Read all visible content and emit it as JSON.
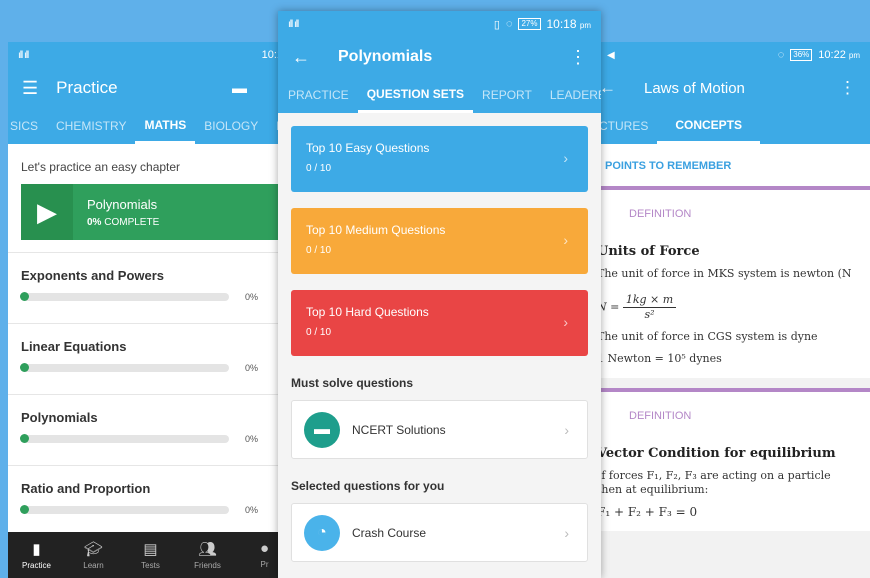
{
  "left": {
    "status": {
      "signal": "ıll ıll",
      "time": "10:1"
    },
    "title": "Practice",
    "tabs": [
      "SICS",
      "CHEMISTRY",
      "MATHS",
      "BIOLOGY",
      "LO"
    ],
    "active_tab": 2,
    "intro": "Let's practice an easy chapter",
    "hero": {
      "title": "Polynomials",
      "pct": "0%",
      "complete_label": "COMPLETE"
    },
    "chapters": [
      {
        "name": "Exponents and Powers",
        "pct": "0%"
      },
      {
        "name": "Linear Equations",
        "pct": "0%"
      },
      {
        "name": "Polynomials",
        "pct": "0%"
      },
      {
        "name": "Ratio and Proportion",
        "pct": "0%"
      }
    ],
    "nav": [
      "Practice",
      "Learn",
      "Tests",
      "Friends",
      "Pr"
    ]
  },
  "center": {
    "status": {
      "signal": "ıll ıll",
      "battery": "27%",
      "time": "10:18",
      "ampm": "pm"
    },
    "title": "Polynomials",
    "tabs": [
      "PRACTICE",
      "QUESTION SETS",
      "REPORT",
      "LEADERB"
    ],
    "active_tab": 1,
    "sets": [
      {
        "title": "Top 10 Easy Questions",
        "progress": "0 / 10",
        "color": "#3daae6"
      },
      {
        "title": "Top 10 Medium Questions",
        "progress": "0 / 10",
        "color": "#f8a93a"
      },
      {
        "title": "Top 10 Hard Questions",
        "progress": "0 / 10",
        "color": "#e94545"
      }
    ],
    "must_solve": "Must solve questions",
    "ncert": "NCERT Solutions",
    "selected": "Selected questions for you",
    "crash": "Crash Course"
  },
  "right": {
    "status": {
      "battery": "36%",
      "time": "10:22",
      "ampm": "pm"
    },
    "title": "Laws of Motion",
    "tabs": [
      "CTURES",
      "CONCEPTS"
    ],
    "active_tab": 1,
    "ptr": "POINTS TO REMEMBER",
    "definition_label": "DEFINITION",
    "card1": {
      "heading": "Units of Force",
      "line1": "The unit of force in MKS system is newton (N",
      "formula_lhs": "N =",
      "formula_num": "1kg × m",
      "formula_den": "s²",
      "line2": "The unit of force in CGS system is dyne",
      "line3": "1 Newton = 10⁵ dynes"
    },
    "card2": {
      "heading": "Vector Condition for equilibrium",
      "line1": "If forces F₁, F₂, F₃ are acting on a particle",
      "line2": "then at equilibrium:",
      "line3": "F₁ + F₂ + F₃ = 0"
    }
  }
}
